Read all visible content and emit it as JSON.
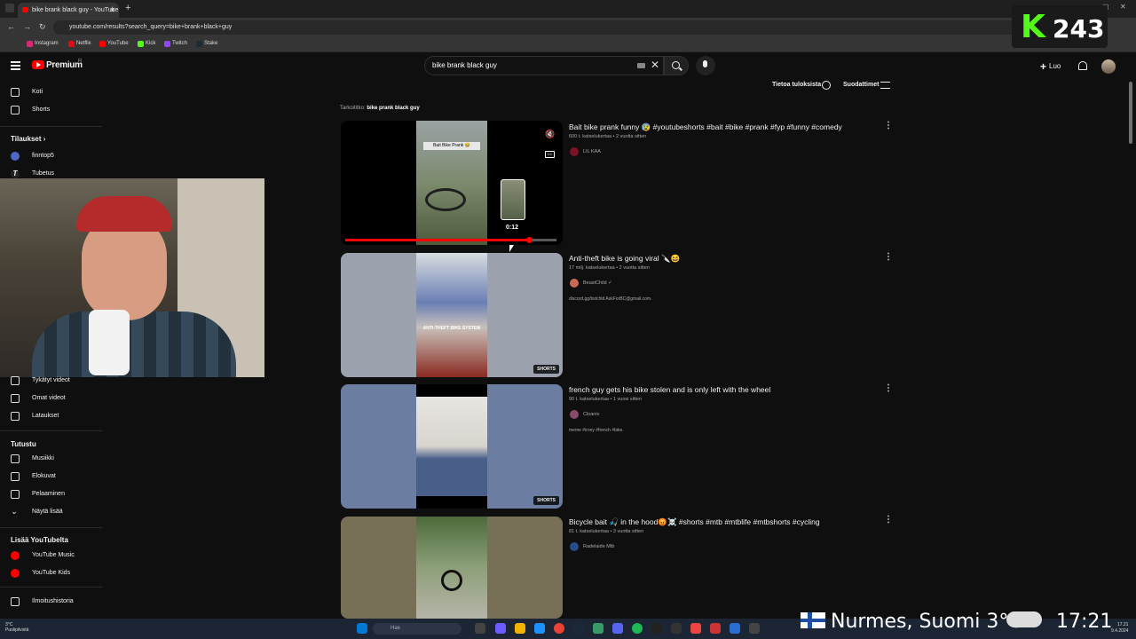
{
  "browser": {
    "tab_title": "bike brank black guy - YouTube",
    "new_tab": "+",
    "url": "youtube.com/results?search_query=bike+brank+black+guy",
    "bookmarks": [
      "Instagram",
      "Netflix",
      "YouTube",
      "Kick",
      "Twitch",
      "Stake"
    ],
    "bookmark_colors": [
      "#d62976",
      "#e50914",
      "#ff0000",
      "#53fc18",
      "#9146ff",
      "#1a2c38"
    ]
  },
  "kick_overlay": {
    "logo": "K",
    "count": "243"
  },
  "header": {
    "logo_text": "Premium",
    "logo_sup": "FI",
    "search_value": "bike brank black guy",
    "create_label": "Luo"
  },
  "sidebar": {
    "items_top": [
      "Koti",
      "Shorts"
    ],
    "subs_title": "Tilaukset",
    "subs": [
      "finntop5",
      "Tubetus"
    ],
    "items_you": [
      "Tykätyt videot",
      "Omat videot",
      "Lataukset"
    ],
    "explore_title": "Tutustu",
    "explore": [
      "Musiikki",
      "Elokuvat",
      "Pelaaminen",
      "Näytä lisää"
    ],
    "more_title": "Lisää YouTubelta",
    "more": [
      "YouTube Music",
      "YouTube Kids"
    ],
    "bottom": [
      "Ilmoitushistoria"
    ]
  },
  "results_header": {
    "about": "Tietoa tuloksista",
    "filters": "Suodattimet",
    "did_you_mean_prefix": "Tarkoititko:",
    "did_you_mean_query": "bike prank black guy"
  },
  "videos": [
    {
      "title": "Bait bike prank funny 😰 #youtubeshorts #bait #bike #prank #fyp #funny #comedy",
      "meta": "600 t. katselukertaa • 2 vuotta sitten",
      "channel": "LIL KAA",
      "thumb_caption": "Bait Bike Prank 😂",
      "timecode": "0:12",
      "progress": 0.87
    },
    {
      "title": "Anti-theft bike is going viral 🔪😆",
      "meta": "17 milj. katselukertaa • 2 vuotta sitten",
      "channel": "BeastChild",
      "desc": "discord.gg/bstchld AskForBC@gmail.com.",
      "thumb_caption": "ANTI-THEFT BIKE SYSTEM",
      "badge": "SHORTS"
    },
    {
      "title": "french guy gets his bike stolen and is only left with the wheel",
      "meta": "90 t. katselukertaa • 1 vuosi sitten",
      "channel": "Cloanix",
      "desc": "meme #irony #french #bike.",
      "badge": "SHORTS"
    },
    {
      "title": "Bicycle bait 🎣 in the hood😡☠️ #shorts #mtb #mtblife #mtbshorts #cycling",
      "meta": "81 t. katselukertaa • 3 vuotta sitten",
      "channel": "Radelaide Mtb"
    }
  ],
  "taskbar": {
    "weather_temp": "3°C",
    "weather_desc": "Puolipilvistä",
    "search_placeholder": "Hae",
    "time": "17.21",
    "date": "9.4.2024"
  },
  "stream_overlay": {
    "location": "Nurmes, Suomi 3°C",
    "time": "17:21"
  }
}
